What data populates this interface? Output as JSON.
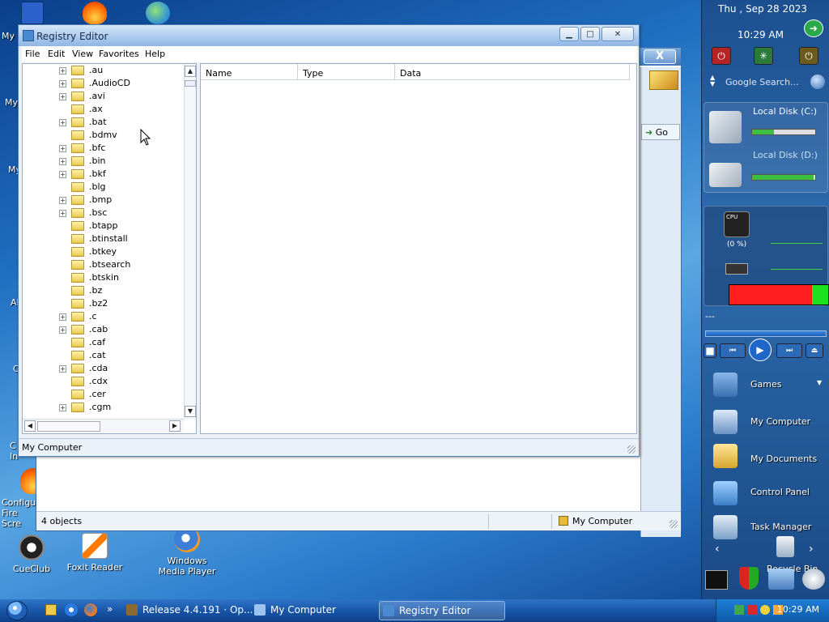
{
  "desktop": {
    "icons": [
      {
        "label": "CueClub"
      },
      {
        "label": "Foxit Reader"
      },
      {
        "label": "Windows Media Player"
      },
      {
        "label": "Configure Fire Scre"
      }
    ],
    "edge_labels": [
      "My I",
      "My",
      "My",
      "Al",
      "C",
      "C In"
    ]
  },
  "sidebar": {
    "date": "Thu , Sep 28 2023",
    "time": "10:29 AM",
    "search_placeholder": "Google Search...",
    "disk_c": {
      "label": "Local Disk (C:)",
      "usage_fraction": 0.35
    },
    "disk_d": {
      "label": "Local Disk (D:)",
      "usage_fraction": 0.98
    },
    "cpu": {
      "label": "(0 %)",
      "meter_label": "CPU"
    },
    "dots": "---",
    "items": [
      {
        "label": "Games"
      },
      {
        "label": "My Computer"
      },
      {
        "label": "My Documents"
      },
      {
        "label": "Control Panel"
      },
      {
        "label": "Task Manager"
      },
      {
        "label": "Recycle Bin"
      }
    ]
  },
  "back_window": {
    "close_label": "X",
    "go_label": "Go",
    "status_left": "4 objects",
    "status_right": "My Computer"
  },
  "registry_editor": {
    "title": "Registry Editor",
    "menu": [
      "File",
      "Edit",
      "View",
      "Favorites",
      "Help"
    ],
    "tree": [
      {
        "label": ".au",
        "expandable": true
      },
      {
        "label": ".AudioCD",
        "expandable": true
      },
      {
        "label": ".avi",
        "expandable": true
      },
      {
        "label": ".ax",
        "expandable": false
      },
      {
        "label": ".bat",
        "expandable": true
      },
      {
        "label": ".bdmv",
        "expandable": false
      },
      {
        "label": ".bfc",
        "expandable": true
      },
      {
        "label": ".bin",
        "expandable": true
      },
      {
        "label": ".bkf",
        "expandable": true
      },
      {
        "label": ".blg",
        "expandable": false
      },
      {
        "label": ".bmp",
        "expandable": true
      },
      {
        "label": ".bsc",
        "expandable": true
      },
      {
        "label": ".btapp",
        "expandable": false
      },
      {
        "label": ".btinstall",
        "expandable": false
      },
      {
        "label": ".btkey",
        "expandable": false
      },
      {
        "label": ".btsearch",
        "expandable": false
      },
      {
        "label": ".btskin",
        "expandable": false
      },
      {
        "label": ".bz",
        "expandable": false
      },
      {
        "label": ".bz2",
        "expandable": false
      },
      {
        "label": ".c",
        "expandable": true
      },
      {
        "label": ".cab",
        "expandable": true
      },
      {
        "label": ".caf",
        "expandable": false
      },
      {
        "label": ".cat",
        "expandable": false
      },
      {
        "label": ".cda",
        "expandable": true
      },
      {
        "label": ".cdx",
        "expandable": false
      },
      {
        "label": ".cer",
        "expandable": false
      },
      {
        "label": ".cgm",
        "expandable": true
      }
    ],
    "columns": [
      "Name",
      "Type",
      "Data"
    ],
    "status": "My Computer"
  },
  "taskbar": {
    "items": [
      {
        "label": "Release 4.4.191 · Op..."
      },
      {
        "label": "My Computer"
      },
      {
        "label": "Registry Editor"
      }
    ],
    "chevron": "»",
    "clock": "10:29 AM"
  }
}
